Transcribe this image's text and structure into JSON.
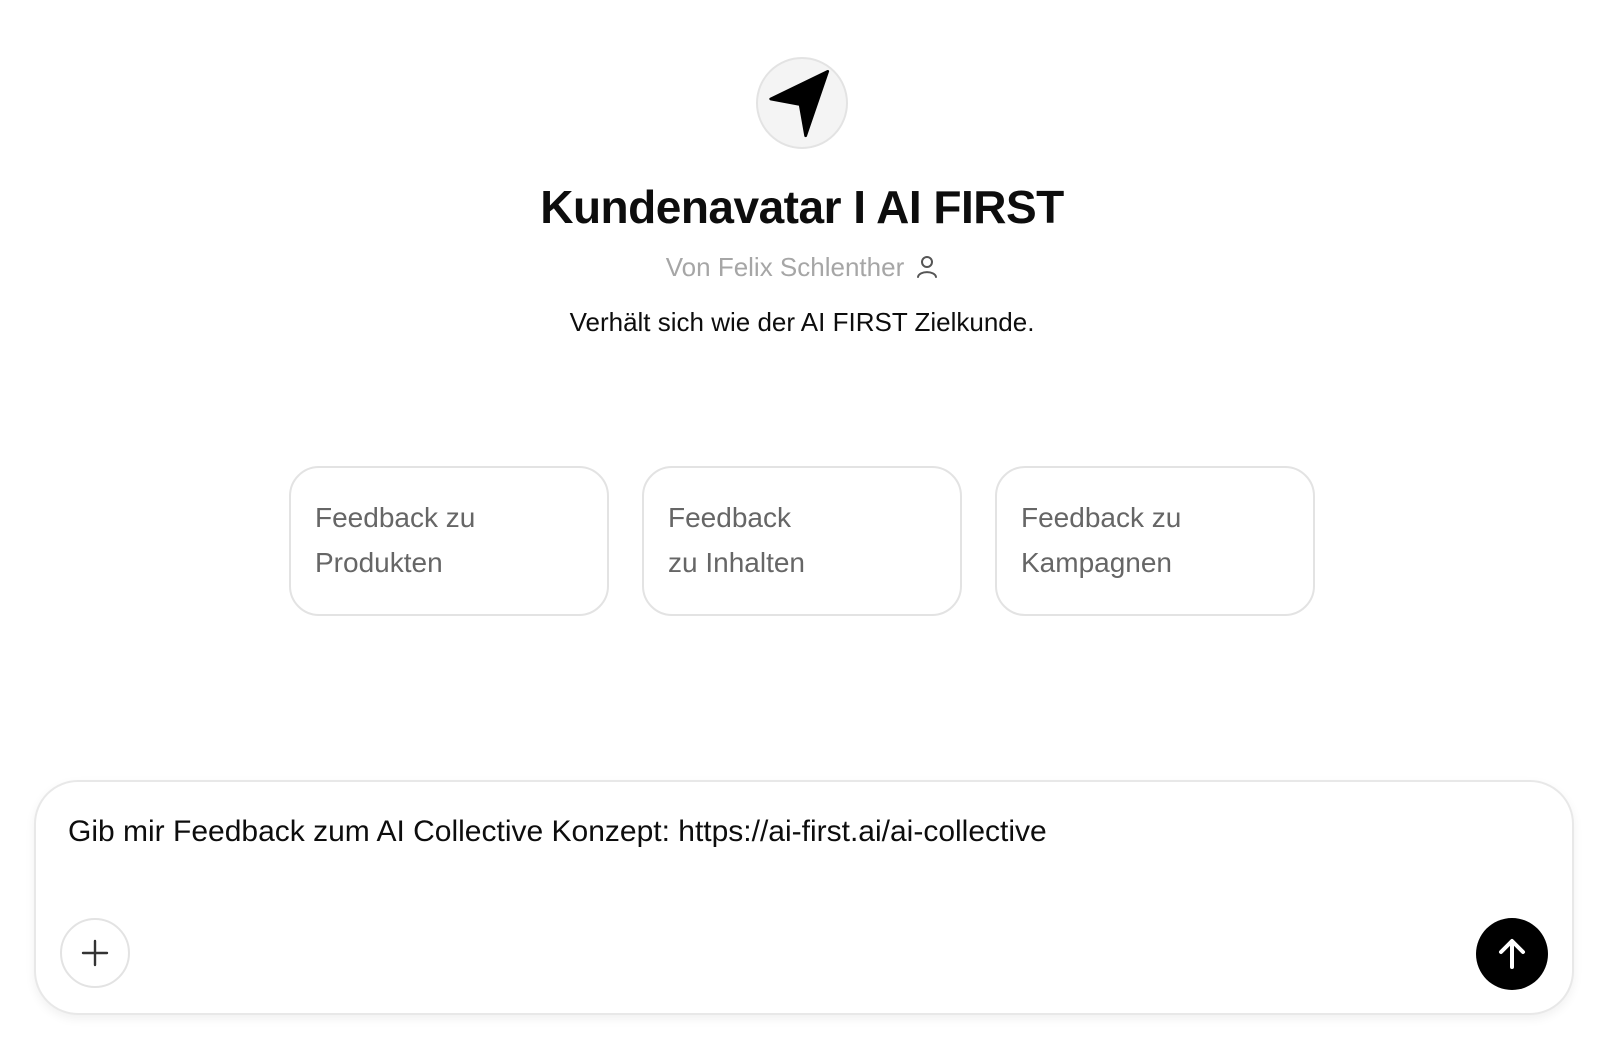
{
  "gpt": {
    "avatar_icon": "navigation-arrow-icon",
    "title": "Kundenavatar I AI FIRST",
    "author": "Von Felix Schlenther",
    "author_icon": "person-icon",
    "description": "Verhält sich wie der AI FIRST Zielkunde."
  },
  "suggestions": [
    {
      "label": "Feedback zu\nProdukten"
    },
    {
      "label": "Feedback\nzu Inhalten"
    },
    {
      "label": "Feedback zu\nKampagnen"
    }
  ],
  "composer": {
    "text": "Gib mir Feedback zum AI Collective Konzept: https://ai-first.ai/ai-collective",
    "plus_icon": "plus-icon",
    "send_icon": "arrow-up-icon"
  },
  "colors": {
    "send_button": "#000000",
    "muted_text": "#a6a6a6",
    "border": "#e3e3e3"
  }
}
